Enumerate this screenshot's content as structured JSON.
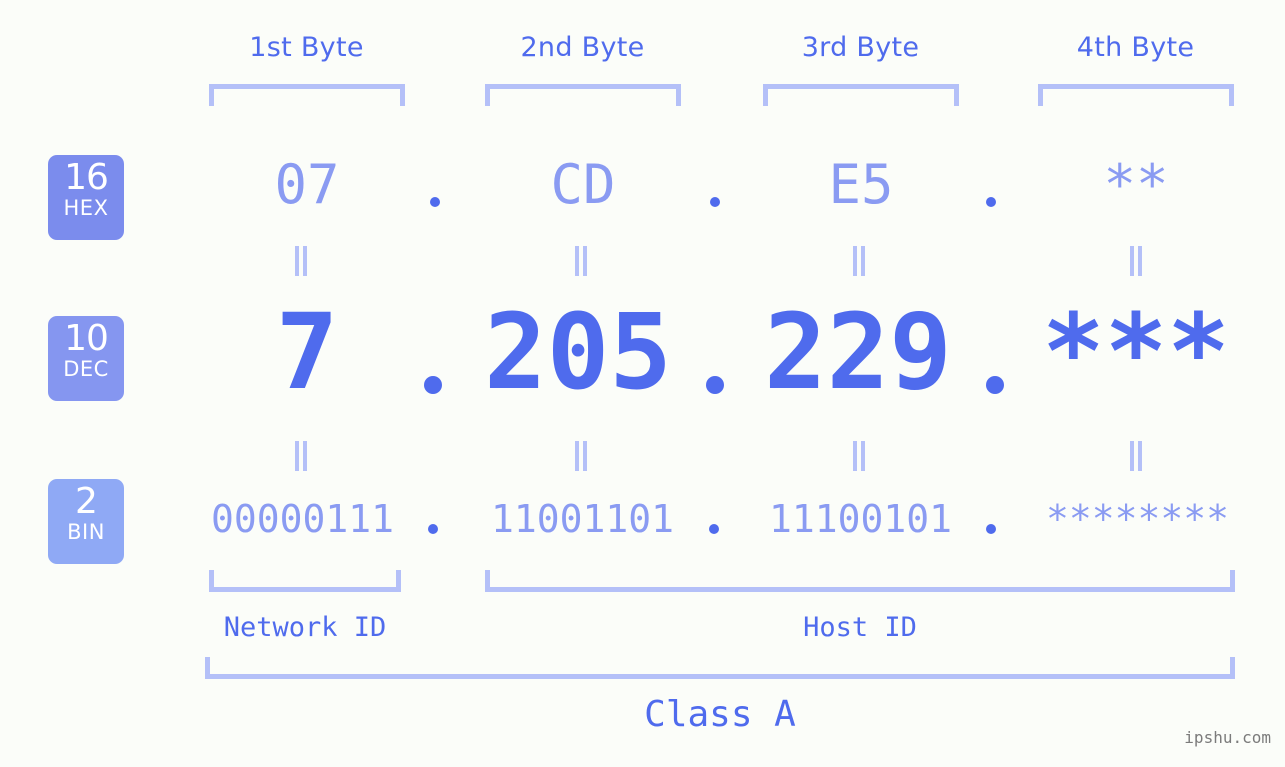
{
  "background_color": "#fbfdf9",
  "accent_color": "#4f6bed",
  "accent_light_color": "#8a9bf2",
  "bracket_color": "#b4c0f8",
  "header": {
    "bytes": [
      {
        "label": "1st Byte"
      },
      {
        "label": "2nd Byte"
      },
      {
        "label": "3rd Byte"
      },
      {
        "label": "4th Byte"
      }
    ]
  },
  "bases": [
    {
      "number": "16",
      "name": "HEX",
      "color": "#7b8ced"
    },
    {
      "number": "10",
      "name": "DEC",
      "color": "#8596f0"
    },
    {
      "number": "2",
      "name": "BIN",
      "color": "#8fa9f5"
    }
  ],
  "rows": {
    "hex": {
      "octets": [
        "07",
        "CD",
        "E5",
        "**"
      ],
      "separator": "."
    },
    "dec": {
      "octets": [
        "7",
        "205",
        "229",
        "***"
      ],
      "separator": "."
    },
    "bin": {
      "octets": [
        "00000111",
        "11001101",
        "11100101",
        "********"
      ],
      "separator": "."
    }
  },
  "equals_marker": "=",
  "footer": {
    "network_id_label": "Network ID",
    "host_id_label": "Host ID",
    "class_label": "Class A"
  },
  "watermark": "ipshu.com"
}
